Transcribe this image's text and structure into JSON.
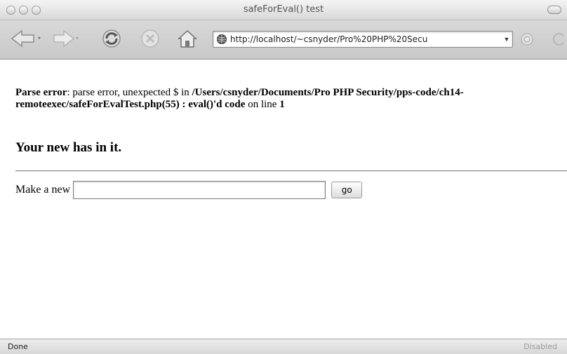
{
  "window": {
    "title": "safeForEval() test"
  },
  "toolbar": {
    "url": "http://localhost/~csnyder/Pro%20PHP%20Secu"
  },
  "page": {
    "error_prefix": "Parse error",
    "error_message": ": parse error, unexpected $ in ",
    "error_path": "/Users/csnyder/Documents/Pro PHP Security/pps-code/ch14-remoteexec/safeForEvalTest.php(55) : eval()'d code",
    "error_on_line": " on line ",
    "error_line_number": "1",
    "heading": "Your new has in it.",
    "form_label": "Make a new",
    "input_value": "",
    "go_label": "go"
  },
  "status": {
    "left": "Done",
    "right": "Disabled"
  }
}
